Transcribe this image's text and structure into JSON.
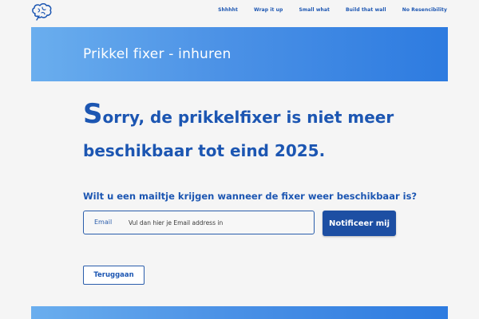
{
  "nav": {
    "items": [
      {
        "label": "Shhhht"
      },
      {
        "label": "Wrap it up"
      },
      {
        "label": "Small what"
      },
      {
        "label": "Build that wall"
      },
      {
        "label": "No Resencibility"
      }
    ]
  },
  "banner": {
    "title": "Prikkel fixer - inhuren"
  },
  "headline": {
    "first_letter": "S",
    "line1_rest": "orry, de prikkelfixer is niet meer",
    "line2": "beschikbaar tot eind 2025."
  },
  "form": {
    "question": "Wilt u een mailtje krijgen wanneer de fixer weer beschikbaar is?",
    "email_label": "Email",
    "email_placeholder": "Vul dan hier je Email address in",
    "email_value": "",
    "notify_label": "Notificeer mij",
    "back_label": "Teruggaan"
  },
  "colors": {
    "primary": "#1c56b2",
    "button": "#1d4fa3",
    "banner_start": "#6aaeee",
    "banner_end": "#2d7be0",
    "background": "#f5f5f5"
  },
  "icons": {
    "logo": "brain-icon"
  }
}
